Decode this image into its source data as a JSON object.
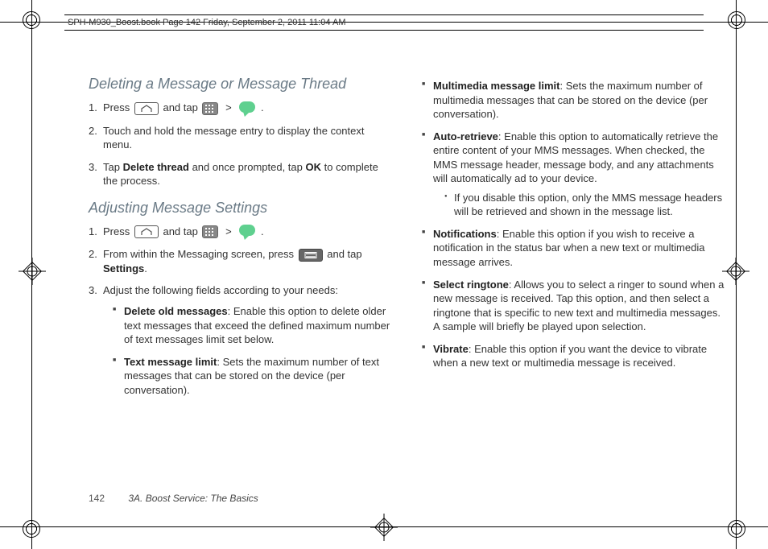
{
  "header": {
    "text": "SPH-M930_Boost.book  Page 142  Friday, September 2, 2011  11:04 AM"
  },
  "footer": {
    "page": "142",
    "section": "3A. Boost Service: The Basics"
  },
  "glyphs": {
    "gt": ">"
  },
  "col1": {
    "h1": "Deleting a Message or Message Thread",
    "s1": {
      "n1": "1.",
      "t1a": "Press ",
      "t1b": " and tap ",
      "t1c": " .",
      "n2": "2.",
      "t2": "Touch and hold the message entry to display the context menu.",
      "n3": "3.",
      "t3a": "Tap ",
      "t3b": "Delete thread",
      "t3c": " and once prompted, tap ",
      "t3d": "OK",
      "t3e": " to complete the process."
    },
    "h2": "Adjusting Message Settings",
    "s2": {
      "n1": "1.",
      "t1a": "Press ",
      "t1b": " and tap ",
      "t1c": " .",
      "n2": "2.",
      "t2a": "From within the Messaging screen, press ",
      "t2b": " and tap ",
      "t2c": "Settings",
      "t2d": ".",
      "n3": "3.",
      "t3": "Adjust the following fields according to your needs:",
      "b1t": "Delete old messages",
      "b1": ": Enable this option to delete older text messages that exceed the defined maximum number of text messages limit set below.",
      "b2t": "Text message limit",
      "b2": ": Sets the maximum number of text messages that can be stored on the device (per conversation)."
    }
  },
  "col2": {
    "b1t": "Multimedia message limit",
    "b1": ": Sets the maximum number of multimedia messages that can be stored on the device (per conversation).",
    "b2t": "Auto-retrieve",
    "b2": ": Enable this option to automatically retrieve the entire content of your MMS messages. When checked, the MMS message header, message body, and any attachments will automatically ad to your device.",
    "b2s1": "If you disable this option, only the MMS message headers will be retrieved and shown in the message list.",
    "b3t": "Notifications",
    "b3": ": Enable this option if you wish to receive a notification in the status bar when a new text or multimedia message arrives.",
    "b4t": "Select ringtone",
    "b4": ": Allows you to select a ringer to sound when a new message is received. Tap this option, and then select a ringtone that is specific to new text and multimedia messages. A sample will briefly be played upon selection.",
    "b5t": "Vibrate",
    "b5": ": Enable this option if you want the device to vibrate when a new text or multimedia message is received."
  }
}
